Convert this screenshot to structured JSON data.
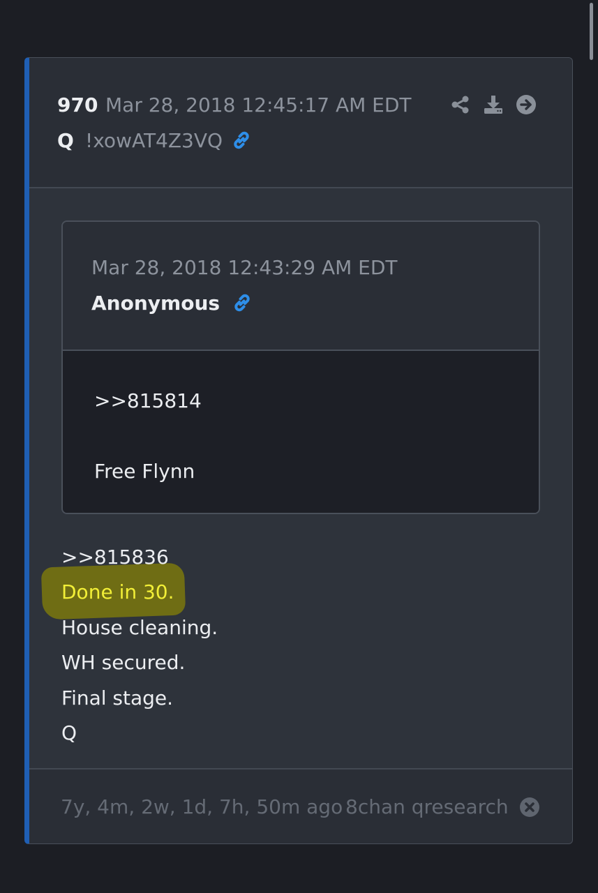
{
  "post": {
    "number": "970",
    "timestamp": "Mar 28, 2018 12:45:17 AM EDT",
    "author": "Q",
    "tripcode": "!xowAT4Z3VQ",
    "actions": {
      "share_icon": "share-icon",
      "download_icon": "download-icon",
      "open_icon": "arrow-circle-right-icon"
    },
    "link_icon": "link-icon"
  },
  "quoted_post": {
    "timestamp": "Mar 28, 2018 12:43:29 AM EDT",
    "author": "Anonymous",
    "link_icon": "link-icon",
    "lines": [
      ">>815814",
      "Free Flynn"
    ]
  },
  "message": {
    "lines": [
      ">>815836",
      "Done in 30.",
      "House cleaning.",
      "WH secured.",
      "Final stage.",
      "Q"
    ],
    "highlighted_line_index": 1
  },
  "footer": {
    "age": "7y, 4m, 2w, 1d, 7h, 50m ago",
    "source": "8chan qresearch",
    "close_icon": "close-circle-icon"
  },
  "colors": {
    "page_background": "#1c1e24",
    "card_background": "#2e333b",
    "accent_border": "#1f5fb4",
    "link_blue": "#2e8ee8",
    "highlight_text": "#f2ef37",
    "highlight_marker": "#6f6d14",
    "muted_text": "#8d939d"
  }
}
